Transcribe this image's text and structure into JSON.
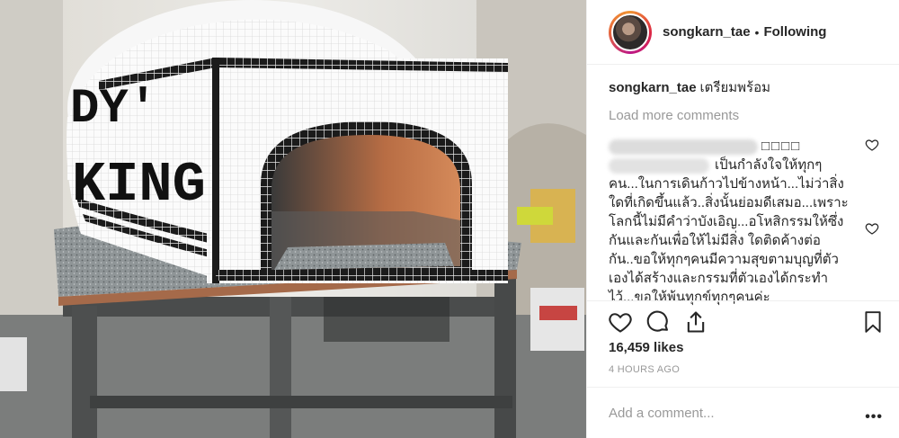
{
  "post": {
    "username": "songkarn_tae",
    "follow_label": "Following",
    "separator": "•",
    "caption": "เตรียมพร้อม",
    "load_more": "Load more comments",
    "comment": {
      "suffix": "□□□□",
      "lines": [
        "เป็นกำลังใจให้ทุกๆ",
        "คน...ในการเดินก้าวไปข้างหน้า...ไม่ว่าสิ่ง",
        "ใดที่เกิดขึ้นแล้ว..สิ่งนั้นย่อมดีเสมอ...เพราะ",
        "โลกนี้ไม่มีคำว่าบังเอิญ...อโหสิกรรมให้ซึ่ง",
        "กันและกันเพื่อให้ไม่มีสิ่ง ใดติดค้างต่อ",
        "กัน..ขอให้ทุกๆคนมีความสุขตามบุญที่ตัว",
        "เองได้สร้างและกรรมที่ตัวเองได้กระทำ",
        "ไว้...ขอให้พ้นทุกข์ทุกๆคนค่ะ"
      ]
    },
    "likes": "16,459 likes",
    "time": "4 HOURS AGO",
    "add_comment_placeholder": "Add a comment...",
    "more_label": "•••",
    "oven_text": {
      "top": "DY'",
      "bottom": "KING"
    }
  },
  "icons": {
    "like": "heart-icon",
    "comment": "comment-icon",
    "share": "share-icon",
    "save": "bookmark-icon"
  },
  "colors": {
    "text": "#262626",
    "muted": "#999999",
    "border": "#efefef"
  }
}
